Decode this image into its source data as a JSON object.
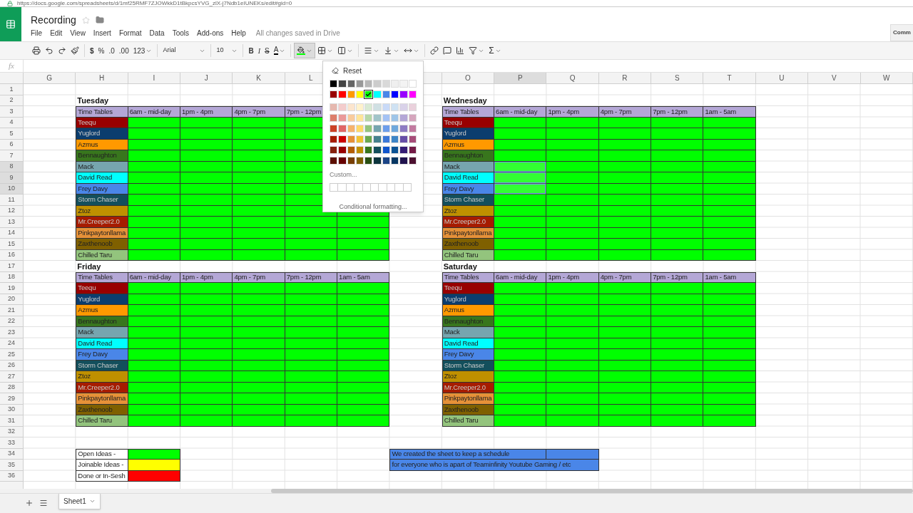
{
  "browser": {
    "url": "https://docs.google.com/spreadsheets/d/1mf25RMF7ZJOWkkD1tBkpcsYVG_zlX-j7Ndb1eIUNEKs/edit#gid=0"
  },
  "document": {
    "title": "Recording",
    "save_status": "All changes saved in Drive",
    "comments_button": "Comm"
  },
  "menu": [
    "File",
    "Edit",
    "View",
    "Insert",
    "Format",
    "Data",
    "Tools",
    "Add-ons",
    "Help"
  ],
  "toolbar": {
    "currency": "$",
    "percent": "%",
    "decrease_decimals": ".0",
    "increase_decimals": ".00",
    "number_format": "123",
    "font": "Arial",
    "font_size": "10",
    "bold": "B",
    "italic": "I",
    "strikethrough": "S",
    "text_color": "A",
    "functions": "Σ",
    "fill_menu_open": true
  },
  "formula_bar": {
    "label": "fx"
  },
  "columns": [
    {
      "label": "G",
      "selected": false
    },
    {
      "label": "H",
      "selected": false
    },
    {
      "label": "I",
      "selected": false
    },
    {
      "label": "J",
      "selected": false
    },
    {
      "label": "K",
      "selected": false
    },
    {
      "label": "L",
      "selected": false
    },
    {
      "label": "O",
      "selected": false
    },
    {
      "label": "P",
      "selected": true
    },
    {
      "label": "Q",
      "selected": false
    },
    {
      "label": "R",
      "selected": false
    },
    {
      "label": "S",
      "selected": false
    },
    {
      "label": "T",
      "selected": false
    },
    {
      "label": "U",
      "selected": false
    },
    {
      "label": "V",
      "selected": false
    },
    {
      "label": "W",
      "selected": false
    }
  ],
  "row_numbers": [
    {
      "label": "1",
      "selected": false
    },
    {
      "label": "2",
      "selected": false
    },
    {
      "label": "3",
      "selected": false
    },
    {
      "label": "4",
      "selected": false
    },
    {
      "label": "5",
      "selected": false
    },
    {
      "label": "6",
      "selected": false
    },
    {
      "label": "7",
      "selected": false
    },
    {
      "label": "8",
      "selected": true
    },
    {
      "label": "9",
      "selected": true
    },
    {
      "label": "10",
      "selected": true
    },
    {
      "label": "11",
      "selected": false
    },
    {
      "label": "12",
      "selected": false
    },
    {
      "label": "13",
      "selected": false
    },
    {
      "label": "14",
      "selected": false
    },
    {
      "label": "15",
      "selected": false
    },
    {
      "label": "16",
      "selected": false
    },
    {
      "label": "17",
      "selected": false
    },
    {
      "label": "18",
      "selected": false
    },
    {
      "label": "19",
      "selected": false
    },
    {
      "label": "20",
      "selected": false
    },
    {
      "label": "21",
      "selected": false
    },
    {
      "label": "22",
      "selected": false
    },
    {
      "label": "23",
      "selected": false
    },
    {
      "label": "24",
      "selected": false
    },
    {
      "label": "25",
      "selected": false
    },
    {
      "label": "26",
      "selected": false
    },
    {
      "label": "27",
      "selected": false
    },
    {
      "label": "28",
      "selected": false
    },
    {
      "label": "29",
      "selected": false
    },
    {
      "label": "30",
      "selected": false
    },
    {
      "label": "31",
      "selected": false
    },
    {
      "label": "32",
      "selected": false
    },
    {
      "label": "33",
      "selected": false
    },
    {
      "label": "34",
      "selected": false
    },
    {
      "label": "35",
      "selected": false
    },
    {
      "label": "36",
      "selected": false
    }
  ],
  "tables": [
    {
      "title": "Tuesday",
      "headers": [
        "Time Tables",
        "6am - mid-day",
        "1pm - 4pm",
        "4pm - 7pm",
        "7pm - 12pm"
      ],
      "rows": [
        {
          "name": "Teequ",
          "color": "#980000",
          "selected": false
        },
        {
          "name": "Yuglord",
          "color": "#0b3d6e",
          "selected": false
        },
        {
          "name": "Azmus",
          "color": "#ff9900",
          "selected": false
        },
        {
          "name": "Bennaughton",
          "color": "#38761d",
          "selected": false
        },
        {
          "name": "Mack",
          "color": "#76a5af",
          "selected": false
        },
        {
          "name": "David Read",
          "color": "#00ffff",
          "selected": false
        },
        {
          "name": "Frey Davy",
          "color": "#4a86e8",
          "selected": false
        },
        {
          "name": "Storm Chaser",
          "color": "#134f5c",
          "selected": false
        },
        {
          "name": "Ztoz",
          "color": "#bf9000",
          "selected": false
        },
        {
          "name": "Mr.Creeper2.0",
          "color": "#a61c00",
          "selected": false
        },
        {
          "name": "Pinkpaytonllama",
          "color": "#e69138",
          "selected": false
        },
        {
          "name": "Zaxthenoob",
          "color": "#7f6000",
          "selected": false
        },
        {
          "name": "Chilled Taru",
          "color": "#93c47d",
          "selected": false
        }
      ]
    },
    {
      "title": "Wednesday",
      "headers": [
        "Time Tables",
        "6am - mid-day",
        "1pm - 4pm",
        "4pm - 7pm",
        "7pm - 12pm",
        "1am - 5am"
      ],
      "rows": [
        {
          "name": "Teequ",
          "color": "#980000",
          "selected": false
        },
        {
          "name": "Yuglord",
          "color": "#0b3d6e",
          "selected": false
        },
        {
          "name": "Azmus",
          "color": "#ff9900",
          "selected": false
        },
        {
          "name": "Bennaughton",
          "color": "#38761d",
          "selected": false
        },
        {
          "name": "Mack",
          "color": "#76a5af",
          "selected": true
        },
        {
          "name": "David Read",
          "color": "#00ffff",
          "selected": true
        },
        {
          "name": "Frey Davy",
          "color": "#4a86e8",
          "selected": true
        },
        {
          "name": "Storm Chaser",
          "color": "#134f5c",
          "selected": false
        },
        {
          "name": "Ztoz",
          "color": "#bf9000",
          "selected": false
        },
        {
          "name": "Mr.Creeper2.0",
          "color": "#a61c00",
          "selected": false
        },
        {
          "name": "Pinkpaytonllama",
          "color": "#e69138",
          "selected": false
        },
        {
          "name": "Zaxthenoob",
          "color": "#7f6000",
          "selected": false
        },
        {
          "name": "Chilled Taru",
          "color": "#93c47d",
          "selected": false
        }
      ]
    },
    {
      "title": "Friday",
      "headers": [
        "Time Tables",
        "6am - mid-day",
        "1pm - 4pm",
        "4pm - 7pm",
        "7pm - 12pm",
        "1am - 5am"
      ],
      "rows": [
        {
          "name": "Teequ",
          "color": "#980000",
          "selected": false
        },
        {
          "name": "Yuglord",
          "color": "#0b3d6e",
          "selected": false
        },
        {
          "name": "Azmus",
          "color": "#ff9900",
          "selected": false
        },
        {
          "name": "Bennaughton",
          "color": "#38761d",
          "selected": false
        },
        {
          "name": "Mack",
          "color": "#76a5af",
          "selected": false
        },
        {
          "name": "David Read",
          "color": "#00ffff",
          "selected": false
        },
        {
          "name": "Frey Davy",
          "color": "#4a86e8",
          "selected": false
        },
        {
          "name": "Storm Chaser",
          "color": "#134f5c",
          "selected": false
        },
        {
          "name": "Ztoz",
          "color": "#bf9000",
          "selected": false
        },
        {
          "name": "Mr.Creeper2.0",
          "color": "#a61c00",
          "selected": false
        },
        {
          "name": "Pinkpaytonllama",
          "color": "#e69138",
          "selected": false
        },
        {
          "name": "Zaxthenoob",
          "color": "#7f6000",
          "selected": false
        },
        {
          "name": "Chilled Taru",
          "color": "#93c47d",
          "selected": false
        }
      ]
    },
    {
      "title": "Saturday",
      "headers": [
        "Time Tables",
        "6am - mid-day",
        "1pm - 4pm",
        "4pm - 7pm",
        "7pm - 12pm",
        "1am - 5am"
      ],
      "rows": [
        {
          "name": "Teequ",
          "color": "#980000",
          "selected": false
        },
        {
          "name": "Yuglord",
          "color": "#0b3d6e",
          "selected": false
        },
        {
          "name": "Azmus",
          "color": "#ff9900",
          "selected": false
        },
        {
          "name": "Bennaughton",
          "color": "#38761d",
          "selected": false
        },
        {
          "name": "Mack",
          "color": "#76a5af",
          "selected": false
        },
        {
          "name": "David Read",
          "color": "#00ffff",
          "selected": false
        },
        {
          "name": "Frey Davy",
          "color": "#4a86e8",
          "selected": false
        },
        {
          "name": "Storm Chaser",
          "color": "#134f5c",
          "selected": false
        },
        {
          "name": "Ztoz",
          "color": "#bf9000",
          "selected": false
        },
        {
          "name": "Mr.Creeper2.0",
          "color": "#a61c00",
          "selected": false
        },
        {
          "name": "Pinkpaytonllama",
          "color": "#e69138",
          "selected": false
        },
        {
          "name": "Zaxthenoob",
          "color": "#7f6000",
          "selected": false
        },
        {
          "name": "Chilled Taru",
          "color": "#93c47d",
          "selected": false
        }
      ]
    }
  ],
  "legend": [
    {
      "label": "Open Ideas -",
      "color": "#00ff00"
    },
    {
      "label": "Joinable Ideas -",
      "color": "#ffff00"
    },
    {
      "label": "Done or In-Sesh",
      "color": "#ff0000"
    }
  ],
  "note": {
    "color": "#4a86e8",
    "lines": [
      "We created the sheet to keep a schedule",
      "for everyone who is apart of Teaminfinity Youtube Gaming / etc"
    ]
  },
  "fill_palette": {
    "reset": "Reset",
    "custom": "Custom...",
    "conditional": "Conditional formatting...",
    "swatch_rows": [
      {
        "swatches": [
          {
            "color": "#000000",
            "selected": false
          },
          {
            "color": "#434343",
            "selected": false
          },
          {
            "color": "#666666",
            "selected": false
          },
          {
            "color": "#999999",
            "selected": false
          },
          {
            "color": "#b7b7b7",
            "selected": false
          },
          {
            "color": "#cccccc",
            "selected": false
          },
          {
            "color": "#d9d9d9",
            "selected": false
          },
          {
            "color": "#efefef",
            "selected": false
          },
          {
            "color": "#f3f3f3",
            "selected": false
          },
          {
            "color": "#ffffff",
            "selected": false
          }
        ]
      },
      {
        "swatches": [
          {
            "color": "#980000",
            "selected": false
          },
          {
            "color": "#ff0000",
            "selected": false
          },
          {
            "color": "#ff9900",
            "selected": false
          },
          {
            "color": "#ffff00",
            "selected": false
          },
          {
            "color": "#00ff00",
            "selected": true
          },
          {
            "color": "#00ffff",
            "selected": false
          },
          {
            "color": "#4a86e8",
            "selected": false
          },
          {
            "color": "#0000ff",
            "selected": false
          },
          {
            "color": "#9900ff",
            "selected": false
          },
          {
            "color": "#ff00ff",
            "selected": false
          }
        ]
      },
      {
        "swatches": [
          {
            "color": "#e6b8af",
            "selected": false
          },
          {
            "color": "#f4cccc",
            "selected": false
          },
          {
            "color": "#fce5cd",
            "selected": false
          },
          {
            "color": "#fff2cc",
            "selected": false
          },
          {
            "color": "#d9ead3",
            "selected": false
          },
          {
            "color": "#d0e0e3",
            "selected": false
          },
          {
            "color": "#c9daf8",
            "selected": false
          },
          {
            "color": "#cfe2f3",
            "selected": false
          },
          {
            "color": "#d9d2e9",
            "selected": false
          },
          {
            "color": "#ead1dc",
            "selected": false
          }
        ]
      },
      {
        "swatches": [
          {
            "color": "#dd7e6b",
            "selected": false
          },
          {
            "color": "#ea9999",
            "selected": false
          },
          {
            "color": "#f9cb9c",
            "selected": false
          },
          {
            "color": "#ffe599",
            "selected": false
          },
          {
            "color": "#b6d7a8",
            "selected": false
          },
          {
            "color": "#a2c4c9",
            "selected": false
          },
          {
            "color": "#a4c2f4",
            "selected": false
          },
          {
            "color": "#9fc5e8",
            "selected": false
          },
          {
            "color": "#b4a7d6",
            "selected": false
          },
          {
            "color": "#d5a6bd",
            "selected": false
          }
        ]
      },
      {
        "swatches": [
          {
            "color": "#cc4125",
            "selected": false
          },
          {
            "color": "#e06666",
            "selected": false
          },
          {
            "color": "#f6b26b",
            "selected": false
          },
          {
            "color": "#ffd966",
            "selected": false
          },
          {
            "color": "#93c47d",
            "selected": false
          },
          {
            "color": "#76a5af",
            "selected": false
          },
          {
            "color": "#6d9eeb",
            "selected": false
          },
          {
            "color": "#6fa8dc",
            "selected": false
          },
          {
            "color": "#8e7cc3",
            "selected": false
          },
          {
            "color": "#c27ba0",
            "selected": false
          }
        ]
      },
      {
        "swatches": [
          {
            "color": "#a61c00",
            "selected": false
          },
          {
            "color": "#cc0000",
            "selected": false
          },
          {
            "color": "#e69138",
            "selected": false
          },
          {
            "color": "#f1c232",
            "selected": false
          },
          {
            "color": "#6aa84f",
            "selected": false
          },
          {
            "color": "#45818e",
            "selected": false
          },
          {
            "color": "#3c78d8",
            "selected": false
          },
          {
            "color": "#3d85c6",
            "selected": false
          },
          {
            "color": "#674ea7",
            "selected": false
          },
          {
            "color": "#a64d79",
            "selected": false
          }
        ]
      },
      {
        "swatches": [
          {
            "color": "#85200c",
            "selected": false
          },
          {
            "color": "#990000",
            "selected": false
          },
          {
            "color": "#b45f06",
            "selected": false
          },
          {
            "color": "#bf9000",
            "selected": false
          },
          {
            "color": "#38761d",
            "selected": false
          },
          {
            "color": "#134f5c",
            "selected": false
          },
          {
            "color": "#1155cc",
            "selected": false
          },
          {
            "color": "#0b5394",
            "selected": false
          },
          {
            "color": "#351c75",
            "selected": false
          },
          {
            "color": "#741b47",
            "selected": false
          }
        ]
      },
      {
        "swatches": [
          {
            "color": "#5b0f00",
            "selected": false
          },
          {
            "color": "#660000",
            "selected": false
          },
          {
            "color": "#783f04",
            "selected": false
          },
          {
            "color": "#7f6000",
            "selected": false
          },
          {
            "color": "#274e13",
            "selected": false
          },
          {
            "color": "#0c343d",
            "selected": false
          },
          {
            "color": "#1c4587",
            "selected": false
          },
          {
            "color": "#073763",
            "selected": false
          },
          {
            "color": "#20124d",
            "selected": false
          },
          {
            "color": "#4c1130",
            "selected": false
          }
        ]
      }
    ]
  },
  "sheet_tabs": [
    {
      "label": "Sheet1",
      "selected": true
    }
  ]
}
